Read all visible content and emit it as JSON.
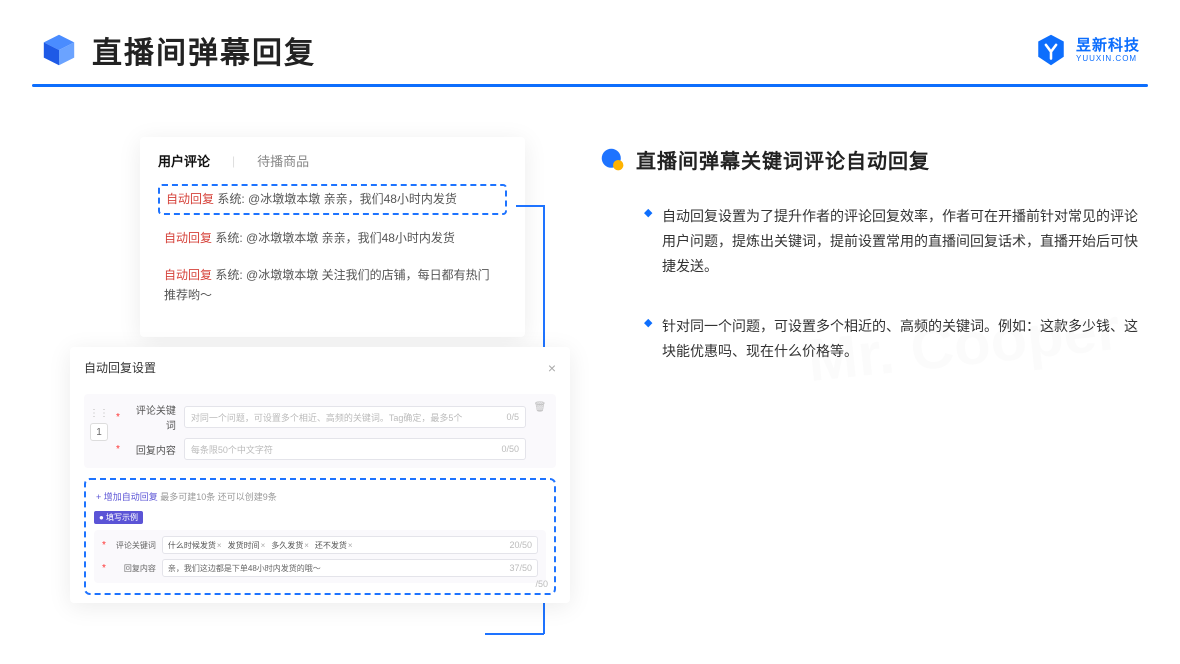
{
  "header": {
    "title": "直播间弹幕回复",
    "brand_cn": "昱新科技",
    "brand_en": "YUUXIN.COM"
  },
  "tabs": {
    "user_comments": "用户评论",
    "pending_goods": "待播商品"
  },
  "comments": [
    {
      "tag": "自动回复",
      "sys": "系统:",
      "text": "@冰墩墩本墩 亲亲，我们48小时内发货"
    },
    {
      "tag": "自动回复",
      "sys": "系统:",
      "text": "@冰墩墩本墩 亲亲，我们48小时内发货"
    },
    {
      "tag": "自动回复",
      "sys": "系统:",
      "text": "@冰墩墩本墩 关注我们的店铺，每日都有热门推荐哟～"
    }
  ],
  "dialog": {
    "title": "自动回复设置",
    "index": "1",
    "keyword_label": "评论关键词",
    "keyword_placeholder": "对同一个问题，可设置多个相近、高频的关键词。Tag确定，最多5个",
    "keyword_counter": "0/5",
    "content_label": "回复内容",
    "content_placeholder": "每条限50个中文字符",
    "content_counter": "0/50",
    "add_link": "+ 增加自动回复",
    "add_hint": "最多可建10条 还可以创建9条",
    "example_badge": "● 填写示例",
    "ex_keyword_label": "评论关键词",
    "ex_tags": [
      "什么时候发货",
      "发货时间",
      "多久发货",
      "还不发货"
    ],
    "ex_keyword_counter": "20/50",
    "ex_content_label": "回复内容",
    "ex_content_value": "亲，我们这边都是下单48小时内发货的哦～",
    "ex_content_counter": "37/50",
    "stray_counter": "/50"
  },
  "right": {
    "section_title": "直播间弹幕关键词评论自动回复",
    "bullets": [
      "自动回复设置为了提升作者的评论回复效率，作者可在开播前针对常见的评论用户问题，提炼出关键词，提前设置常用的直播间回复话术，直播开始后可快捷发送。",
      "针对同一个问题，可设置多个相近的、高频的关键词。例如：这款多少钱、这块能优惠吗、现在什么价格等。"
    ]
  }
}
